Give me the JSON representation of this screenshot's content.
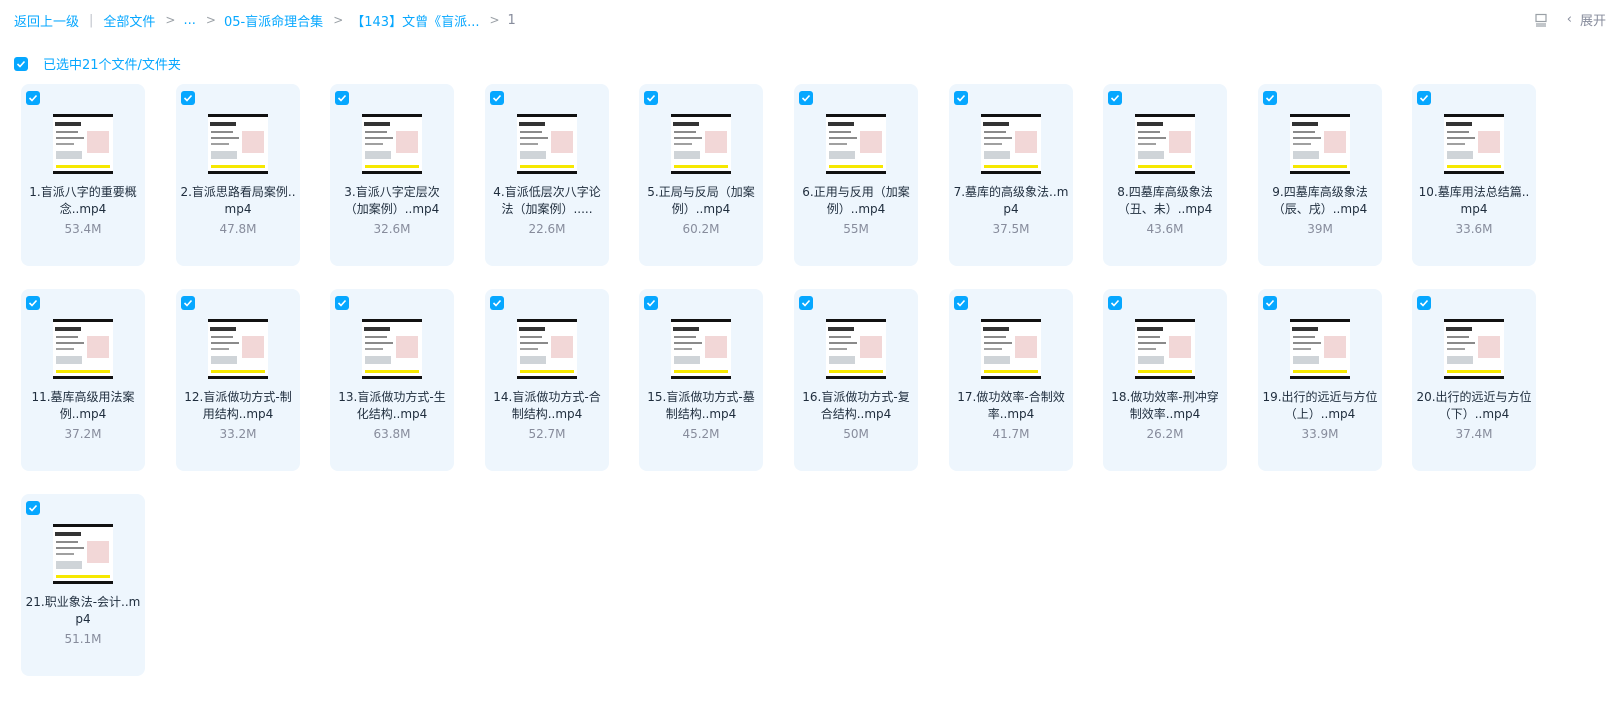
{
  "breadcrumb": {
    "back": "返回上一级",
    "root": "全部文件",
    "ellipsis": "...",
    "folder1": "05-盲派命理合集",
    "folder2": "【143】文曾《盲派...",
    "current": "1"
  },
  "toolbar": {
    "expand_label": "展开",
    "layout_icon": "list-view-icon",
    "chevron_icon": "chevron-left-icon"
  },
  "selection": {
    "label": "已选中21个文件/文件夹"
  },
  "colors": {
    "accent": "#06a7ff",
    "card_bg": "#eef6fd",
    "muted": "#878c9c"
  },
  "files": [
    {
      "name": "1.盲派八字的重要概念..mp4",
      "size": "53.4M"
    },
    {
      "name": "2.盲派思路看局案例..mp4",
      "size": "47.8M"
    },
    {
      "name": "3.盲派八字定层次（加案例）..mp4",
      "size": "32.6M"
    },
    {
      "name": "4.盲派低层次八字论法（加案例）.....",
      "size": "22.6M"
    },
    {
      "name": "5.正局与反局（加案例）..mp4",
      "size": "60.2M"
    },
    {
      "name": "6.正用与反用（加案例）..mp4",
      "size": "55M"
    },
    {
      "name": "7.墓库的高级象法..mp4",
      "size": "37.5M"
    },
    {
      "name": "8.四墓库高级象法（丑、未）..mp4",
      "size": "43.6M"
    },
    {
      "name": "9.四墓库高级象法（辰、戌）..mp4",
      "size": "39M"
    },
    {
      "name": "10.墓库用法总结篇..mp4",
      "size": "33.6M"
    },
    {
      "name": "11.墓库高级用法案例..mp4",
      "size": "37.2M"
    },
    {
      "name": "12.盲派做功方式-制用结构..mp4",
      "size": "33.2M"
    },
    {
      "name": "13.盲派做功方式-生化结构..mp4",
      "size": "63.8M"
    },
    {
      "name": "14.盲派做功方式-合制结构..mp4",
      "size": "52.7M"
    },
    {
      "name": "15.盲派做功方式-墓制结构..mp4",
      "size": "45.2M"
    },
    {
      "name": "16.盲派做功方式-复合结构..mp4",
      "size": "50M"
    },
    {
      "name": "17.做功效率-合制效率..mp4",
      "size": "41.7M"
    },
    {
      "name": "18.做功效率-刑冲穿制效率..mp4",
      "size": "26.2M"
    },
    {
      "name": "19.出行的远近与方位（上）..mp4",
      "size": "33.9M"
    },
    {
      "name": "20.出行的远近与方位（下）..mp4",
      "size": "37.4M"
    },
    {
      "name": "21.职业象法-会计..mp4",
      "size": "51.1M"
    }
  ]
}
